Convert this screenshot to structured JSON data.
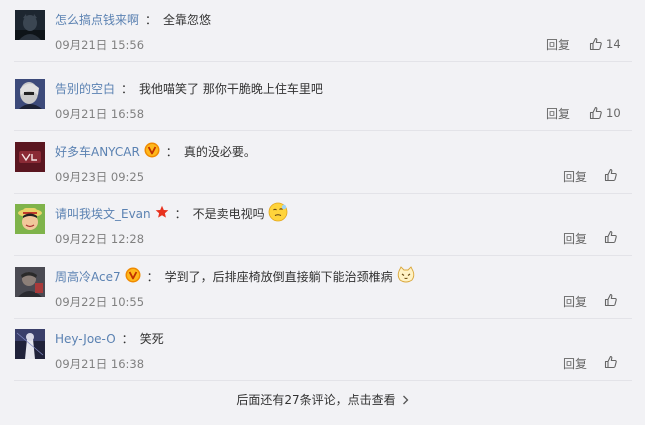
{
  "comments": [
    {
      "username": "怎么搞点钱来啊",
      "colon": "：",
      "text": "全靠忽悠",
      "time": "09月21日 15:56",
      "reply": "回复",
      "likes": "14"
    },
    {
      "username": "告别的空白",
      "colon": "：",
      "text": "我他喵笑了 那你干脆晚上住车里吧",
      "time": "09月21日 16:58",
      "reply": "回复",
      "likes": "10"
    },
    {
      "username": "好多车ANYCAR",
      "colon": "：",
      "text": "真的没必要。",
      "time": "09月23日 09:25",
      "reply": "回复",
      "likes": ""
    },
    {
      "username": "请叫我埃文_Evan",
      "colon": "：",
      "text": "不是卖电视吗",
      "time": "09月22日 12:28",
      "reply": "回复",
      "likes": ""
    },
    {
      "username": "周高冷Ace7",
      "colon": "：",
      "text": "学到了，后排座椅放倒直接躺下能治颈椎病",
      "time": "09月22日 10:55",
      "reply": "回复",
      "likes": ""
    },
    {
      "username": "Hey-Joe-O",
      "colon": "：",
      "text": "笑死",
      "time": "09月21日 16:38",
      "reply": "回复",
      "likes": ""
    }
  ],
  "more_comments": "后面还有27条评论，点击查看",
  "colors": {
    "username": "#5b82b2",
    "badge_v": "#f08a00",
    "badge_star": "#e8321e"
  }
}
